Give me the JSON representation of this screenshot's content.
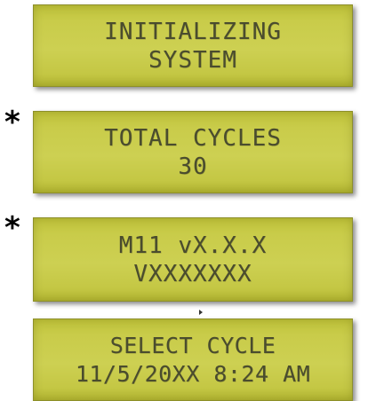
{
  "screens": [
    {
      "line1": "INITIALIZING",
      "line2": "SYSTEM"
    },
    {
      "line1": "TOTAL CYCLES",
      "line2": "30"
    },
    {
      "line1": "M11 vX.X.X",
      "line2": "VXXXXXXX"
    },
    {
      "line1": "SELECT CYCLE",
      "line2": "11/5/20XX 8:24 AM"
    }
  ],
  "markers": {
    "asterisk": "*"
  },
  "colors": {
    "lcd_background": "#c9cc4a",
    "lcd_text": "#4a4c2e"
  }
}
